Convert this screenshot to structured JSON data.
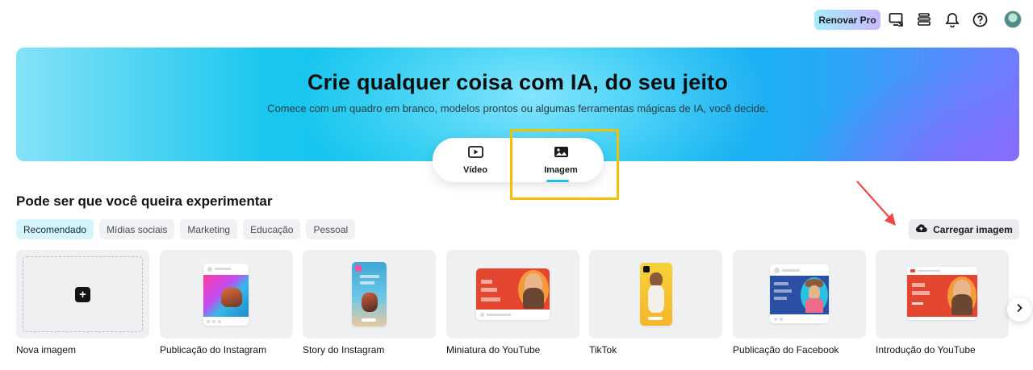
{
  "topbar": {
    "renew_label": "Renovar Pro",
    "icons": [
      "cast-icon",
      "stack-icon",
      "bell-icon",
      "help-icon"
    ]
  },
  "hero": {
    "title": "Crie qualquer coisa com IA, do seu jeito",
    "subtitle": "Comece com um quadro em branco, modelos prontos ou algumas ferramentas mágicas de IA, você decide."
  },
  "mode_tabs": [
    {
      "label": "Vídeo",
      "icon": "play-icon",
      "active": false
    },
    {
      "label": "Imagem",
      "icon": "image-icon",
      "active": true
    }
  ],
  "section": {
    "title": "Pode ser que você queira experimentar",
    "filters": [
      "Recomendado",
      "Mídias sociais",
      "Marketing",
      "Educação",
      "Pessoal"
    ],
    "active_filter": "Recomendado",
    "upload_label": "Carregar imagem"
  },
  "cards": [
    {
      "label": "Nova imagem"
    },
    {
      "label": "Publicação do Instagram"
    },
    {
      "label": "Story do Instagram"
    },
    {
      "label": "Miniatura do YouTube"
    },
    {
      "label": "TikTok"
    },
    {
      "label": "Publicação do Facebook"
    },
    {
      "label": "Introdução do YouTube"
    }
  ],
  "colors": {
    "accent_cyan": "#18c3e6",
    "highlight_yellow": "#f2c200",
    "arrow_red": "#ef4a4a"
  }
}
